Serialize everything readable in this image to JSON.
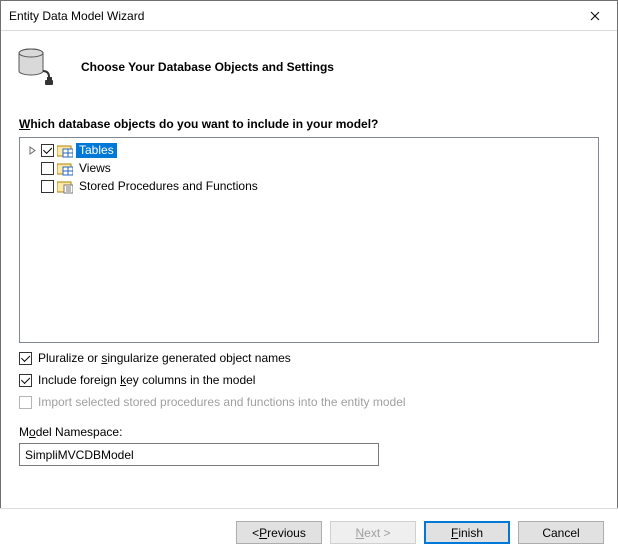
{
  "window": {
    "title": "Entity Data Model Wizard"
  },
  "header": {
    "heading": "Choose Your Database Objects and Settings"
  },
  "question": "Which database objects do you want to include in your model?",
  "tree": {
    "items": [
      {
        "label": "Tables",
        "checked": true,
        "selected": true,
        "expandable": true
      },
      {
        "label": "Views",
        "checked": false,
        "selected": false,
        "expandable": false
      },
      {
        "label": "Stored Procedures and Functions",
        "checked": false,
        "selected": false,
        "expandable": false
      }
    ]
  },
  "options": {
    "pluralize": {
      "label": "Pluralize or singularize generated object names",
      "checked": true,
      "enabled": true
    },
    "foreignKeys": {
      "label": "Include foreign key columns in the model",
      "checked": true,
      "enabled": true
    },
    "importSprocs": {
      "label": "Import selected stored procedures and functions into the entity model",
      "checked": false,
      "enabled": false
    }
  },
  "namespace": {
    "label": "Model Namespace:",
    "value": "SimpliMVCDBModel"
  },
  "buttons": {
    "previous": "< Previous",
    "next": "Next >",
    "finish": "Finish",
    "cancel": "Cancel"
  }
}
